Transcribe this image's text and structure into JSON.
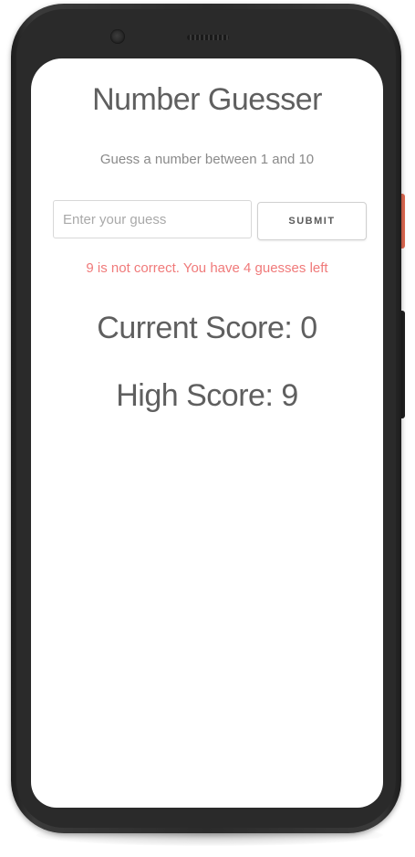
{
  "device": {
    "frame_color": "#2b2b2b",
    "power_button_color": "#e06a52"
  },
  "app": {
    "title": "Number Guesser",
    "instructions": "Guess a number between 1 and 10",
    "input": {
      "value": "",
      "placeholder": "Enter your guess"
    },
    "submit_label": "SUBMIT",
    "feedback": "9 is not correct. You have 4 guesses left",
    "feedback_color": "#f07a7a",
    "current_score_text": "Current Score: 0",
    "high_score_text": "High Score: 9"
  }
}
